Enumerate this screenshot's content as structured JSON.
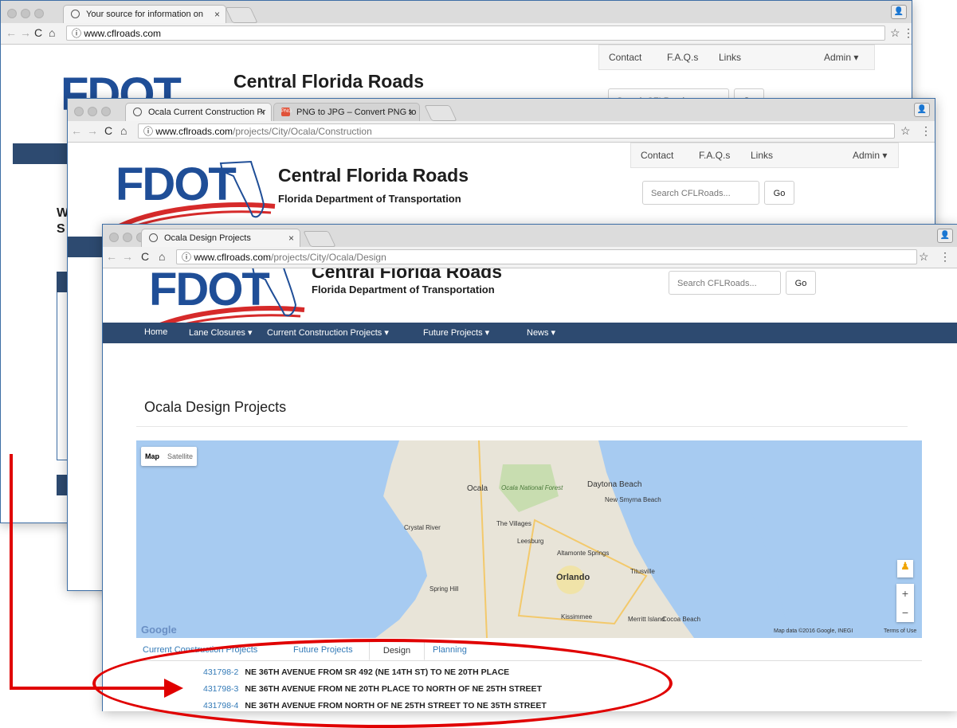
{
  "window1": {
    "tab_title": "Your source for information on",
    "url_host": "www.cflroads.com",
    "url_path": "",
    "site": {
      "logo": "FDOT",
      "title": "Central Florida Roads",
      "search_placeholder": "Search CFLRoads..."
    },
    "topnav": [
      "Contact",
      "F.A.Q.s",
      "Links",
      "Admin ▾"
    ],
    "go_label": "Go",
    "left_text": [
      "W",
      "S"
    ]
  },
  "window2": {
    "tabs": [
      {
        "title": "Ocala Current Construction Pr"
      },
      {
        "title": "PNG to JPG – Convert PNG to"
      }
    ],
    "url_host": "www.cflroads.com",
    "url_path": "/projects/City/Ocala/Construction",
    "site": {
      "logo": "FDOT",
      "title": "Central Florida Roads",
      "subtitle": "Florida Department of Transportation",
      "search_placeholder": "Search CFLRoads..."
    },
    "topnav": [
      "Contact",
      "F.A.Q.s",
      "Links",
      "Admin ▾"
    ],
    "go_label": "Go"
  },
  "window3": {
    "tab_title": "Ocala Design Projects",
    "url_host": "www.cflroads.com",
    "url_path": "/projects/City/Ocala/Design",
    "site": {
      "logo": "FDOT",
      "title": "Central Florida Roads",
      "subtitle": "Florida Department of Transportation",
      "search_placeholder": "Search CFLRoads..."
    },
    "go_label": "Go",
    "nav": [
      "Home",
      "Lane Closures ▾",
      "Current Construction Projects ▾",
      "Future Projects ▾",
      "News ▾"
    ],
    "page_title": "Ocala Design Projects",
    "map": {
      "type_buttons": [
        "Map",
        "Satellite"
      ],
      "places": [
        "Ocala",
        "Ocala National Forest",
        "Daytona Beach",
        "New Smyrna Beach",
        "Crystal River",
        "The Villages",
        "Leesburg",
        "Altamonte Springs",
        "Orlando",
        "Titusville",
        "Spring Hill",
        "Kissimmee",
        "Merritt Island",
        "Cocoa Beach"
      ],
      "brand": "Google",
      "attribution": "Map data ©2016 Google, INEGI",
      "terms": "Terms of Use",
      "zoom_in": "+",
      "zoom_out": "−"
    },
    "tabs": [
      "Current Construction Projects",
      "Future Projects",
      "Design",
      "Planning"
    ],
    "active_tab": "Design",
    "projects": [
      {
        "id": "431798-2",
        "desc": "NE 36TH AVENUE FROM SR 492 (NE 14TH ST) TO NE 20TH PLACE"
      },
      {
        "id": "431798-3",
        "desc": "NE 36TH AVENUE FROM NE 20TH PLACE TO NORTH OF NE 25TH STREET"
      },
      {
        "id": "431798-4",
        "desc": "NE 36TH AVENUE FROM NORTH OF NE 25TH STREET TO NE 35TH STREET"
      }
    ]
  },
  "colors": {
    "navbar": "#2d4a70",
    "link": "#337ab7",
    "logo": "#1f4e97",
    "annotation": "#e00000"
  }
}
